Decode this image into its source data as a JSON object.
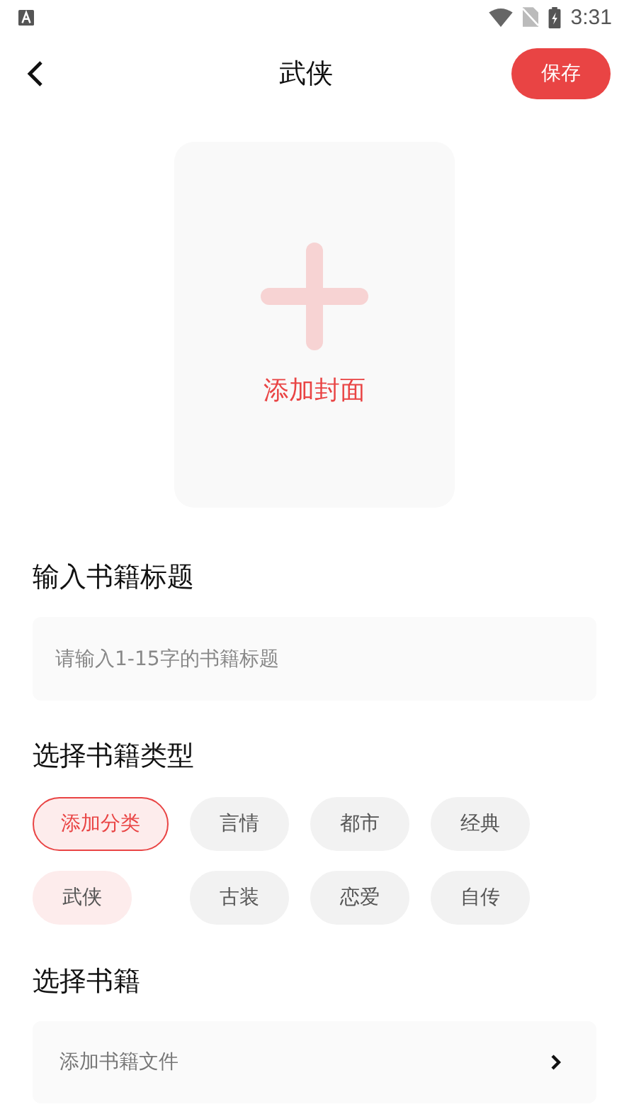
{
  "status_bar": {
    "time": "3:31"
  },
  "header": {
    "title": "武侠",
    "save_button": "保存"
  },
  "cover": {
    "label": "添加封面"
  },
  "title_section": {
    "heading": "输入书籍标题",
    "placeholder": "请输入1-15字的书籍标题"
  },
  "type_section": {
    "heading": "选择书籍类型",
    "chips": [
      {
        "label": "添加分类",
        "kind": "add"
      },
      {
        "label": "言情",
        "kind": "category",
        "selected": false
      },
      {
        "label": "都市",
        "kind": "category",
        "selected": false
      },
      {
        "label": "经典",
        "kind": "category",
        "selected": false
      },
      {
        "label": "武侠",
        "kind": "category",
        "selected": true
      },
      {
        "label": "古装",
        "kind": "category",
        "selected": false
      },
      {
        "label": "恋爱",
        "kind": "category",
        "selected": false
      },
      {
        "label": "自传",
        "kind": "category",
        "selected": false
      }
    ]
  },
  "book_section": {
    "heading": "选择书籍",
    "file_row": "添加书籍文件"
  }
}
